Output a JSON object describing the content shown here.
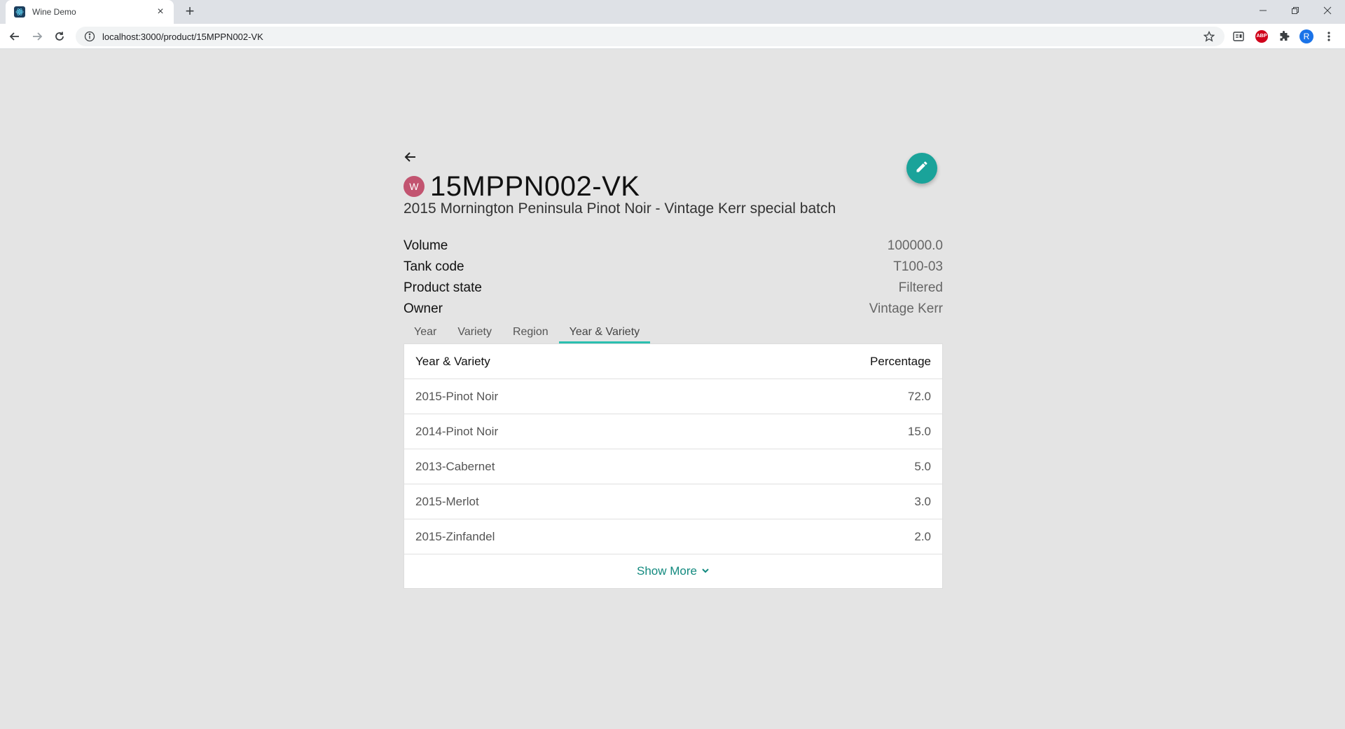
{
  "browser": {
    "tab_title": "Wine Demo",
    "url": "localhost:3000/product/15MPPN002-VK",
    "profile_initial": "R",
    "abp_label": "ABP"
  },
  "product": {
    "owner_initial": "W",
    "code": "15MPPN002-VK",
    "description": "2015 Mornington Peninsula Pinot Noir - Vintage Kerr special batch",
    "details": [
      {
        "label": "Volume",
        "value": "100000.0"
      },
      {
        "label": "Tank code",
        "value": "T100-03"
      },
      {
        "label": "Product state",
        "value": "Filtered"
      },
      {
        "label": "Owner",
        "value": "Vintage Kerr"
      }
    ]
  },
  "composition_tabs": [
    {
      "label": "Year",
      "active": false
    },
    {
      "label": "Variety",
      "active": false
    },
    {
      "label": "Region",
      "active": false
    },
    {
      "label": "Year & Variety",
      "active": true
    }
  ],
  "table": {
    "headers": [
      "Year & Variety",
      "Percentage"
    ],
    "rows": [
      [
        "2015-Pinot Noir",
        "72.0"
      ],
      [
        "2014-Pinot Noir",
        "15.0"
      ],
      [
        "2013-Cabernet",
        "5.0"
      ],
      [
        "2015-Merlot",
        "3.0"
      ],
      [
        "2015-Zinfandel",
        "2.0"
      ]
    ],
    "show_more_label": "Show More"
  },
  "colors": {
    "accent": "#1aa39a",
    "tab_indicator": "#2bbfb0",
    "avatar": "#c25470",
    "link": "#138a7f"
  }
}
